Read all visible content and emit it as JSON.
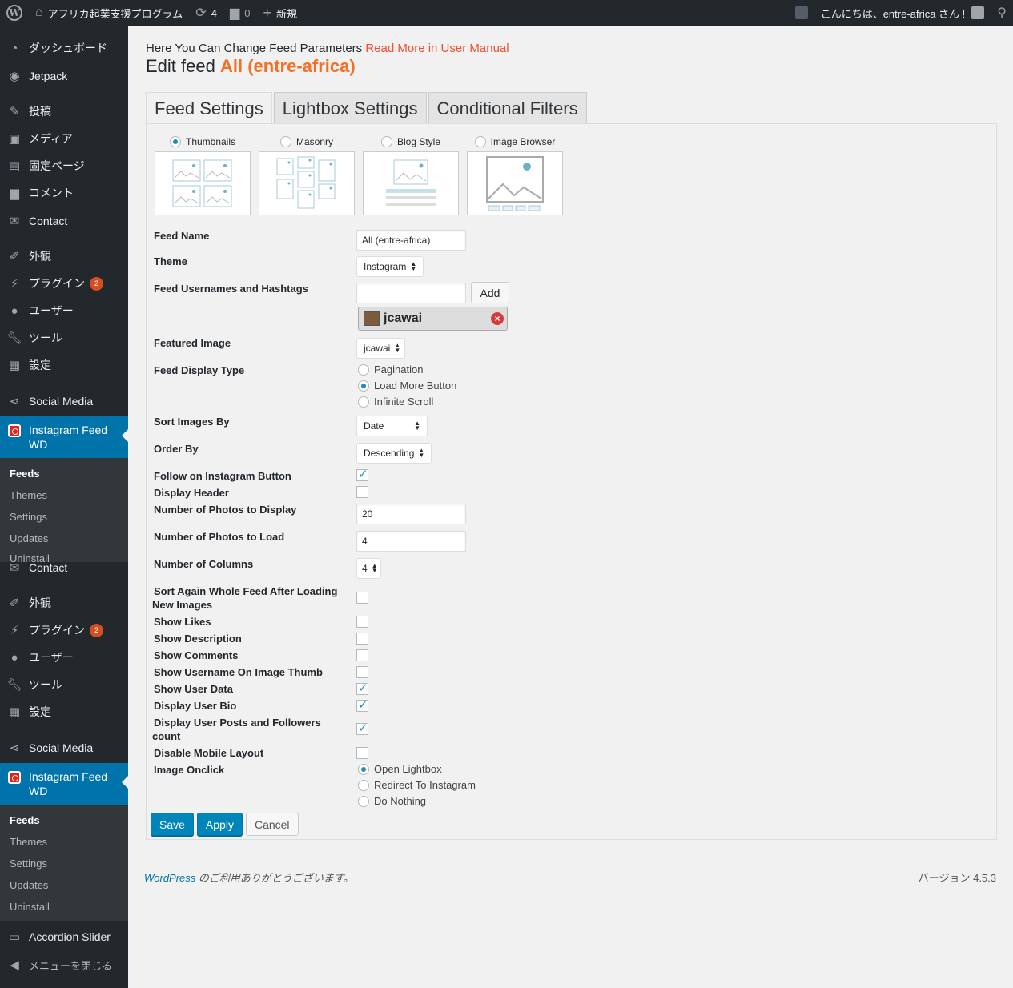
{
  "adminbar": {
    "site_name": "アフリカ起業支援プログラム",
    "updates_count": "4",
    "comments_count": "0",
    "new_label": "新規",
    "greeting": "こんにちは、entre-africa さん !"
  },
  "sidebar": {
    "items": [
      {
        "label": "ダッシュボード",
        "icon": "dashboard-icon"
      },
      {
        "label": "Jetpack",
        "icon": "jetpack-icon"
      },
      {
        "label": "投稿",
        "icon": "pin-icon"
      },
      {
        "label": "メディア",
        "icon": "media-icon"
      },
      {
        "label": "固定ページ",
        "icon": "page-icon"
      },
      {
        "label": "コメント",
        "icon": "comment-icon"
      },
      {
        "label": "Contact",
        "icon": "mail-icon"
      },
      {
        "label": "外観",
        "icon": "brush-icon"
      },
      {
        "label": "プラグイン",
        "icon": "plugin-icon",
        "badge": "2"
      },
      {
        "label": "ユーザー",
        "icon": "user-icon"
      },
      {
        "label": "ツール",
        "icon": "wrench-icon"
      },
      {
        "label": "設定",
        "icon": "settings-icon"
      },
      {
        "label": "Social Media",
        "icon": "share-icon"
      },
      {
        "label": "Instagram Feed WD",
        "icon": "instagram-icon"
      }
    ],
    "submenu": [
      "Feeds",
      "Themes",
      "Settings",
      "Updates",
      "Uninstall"
    ],
    "items_repeat": [
      {
        "label": "Contact"
      },
      {
        "label": "外観"
      },
      {
        "label": "プラグイン",
        "badge": "2"
      },
      {
        "label": "ユーザー"
      },
      {
        "label": "ツール"
      },
      {
        "label": "設定"
      },
      {
        "label": "Social Media"
      },
      {
        "label": "Instagram Feed WD"
      }
    ],
    "accordion_slider": "Accordion Slider",
    "collapse": "メニューを閉じる"
  },
  "header": {
    "subtitle": "Here You Can Change Feed Parameters",
    "manual_link": "Read More in User Manual",
    "title_prefix": "Edit feed",
    "feed_name": "All (entre-africa)"
  },
  "tabs": [
    "Feed Settings",
    "Lightbox Settings",
    "Conditional Filters"
  ],
  "layouts": [
    {
      "label": "Thumbnails",
      "selected": true
    },
    {
      "label": "Masonry",
      "selected": false
    },
    {
      "label": "Blog Style",
      "selected": false
    },
    {
      "label": "Image Browser",
      "selected": false
    }
  ],
  "form": {
    "feed_name_label": "Feed Name",
    "feed_name_value": "All (entre-africa)",
    "theme_label": "Theme",
    "theme_value": "Instagram",
    "usernames_label": "Feed Usernames and Hashtags",
    "usernames_value": "",
    "add_button": "Add",
    "user_chip": "jcawai",
    "featured_label": "Featured Image",
    "featured_value": "jcawai",
    "display_type_label": "Feed Display Type",
    "display_type_options": [
      "Pagination",
      "Load More Button",
      "Infinite Scroll"
    ],
    "display_type_selected": "Load More Button",
    "sort_label": "Sort Images By",
    "sort_value": "Date",
    "order_label": "Order By",
    "order_value": "Descending",
    "follow_label": "Follow on Instagram Button",
    "header_label": "Display Header",
    "photos_display_label": "Number of Photos to Display",
    "photos_display_value": "20",
    "photos_load_label": "Number of Photos to Load",
    "photos_load_value": "4",
    "columns_label": "Number of Columns",
    "columns_value": "4",
    "sort_again_label_1": "Sort Again Whole Feed After Loading",
    "sort_again_label_2": "New Images",
    "likes_label": "Show Likes",
    "description_label": "Show Description",
    "comments_label": "Show Comments",
    "username_thumb_label": "Show Username On Image Thumb",
    "user_data_label": "Show User Data",
    "user_bio_label": "Display User Bio",
    "posts_followers_label_1": "Display User Posts and Followers",
    "posts_followers_label_2": "count",
    "mobile_label": "Disable Mobile Layout",
    "onclick_label": "Image Onclick",
    "onclick_options": [
      "Open Lightbox",
      "Redirect To Instagram",
      "Do Nothing"
    ],
    "onclick_selected": "Open Lightbox"
  },
  "checkboxes": {
    "follow": true,
    "header": false,
    "sort_again": false,
    "likes": false,
    "description": false,
    "comments": false,
    "username_thumb": false,
    "user_data": true,
    "user_bio": true,
    "posts_followers": true,
    "mobile": false
  },
  "actions": {
    "save": "Save",
    "apply": "Apply",
    "cancel": "Cancel"
  },
  "footer": {
    "wp_link": "WordPress",
    "thanks": " のご利用ありがとうございます。",
    "version": "バージョン 4.5.3"
  },
  "colors": {
    "accent": "#0073aa",
    "orange": "#f36f21",
    "link_red": "#f44d2f",
    "sidebar_bg": "#23282d"
  }
}
